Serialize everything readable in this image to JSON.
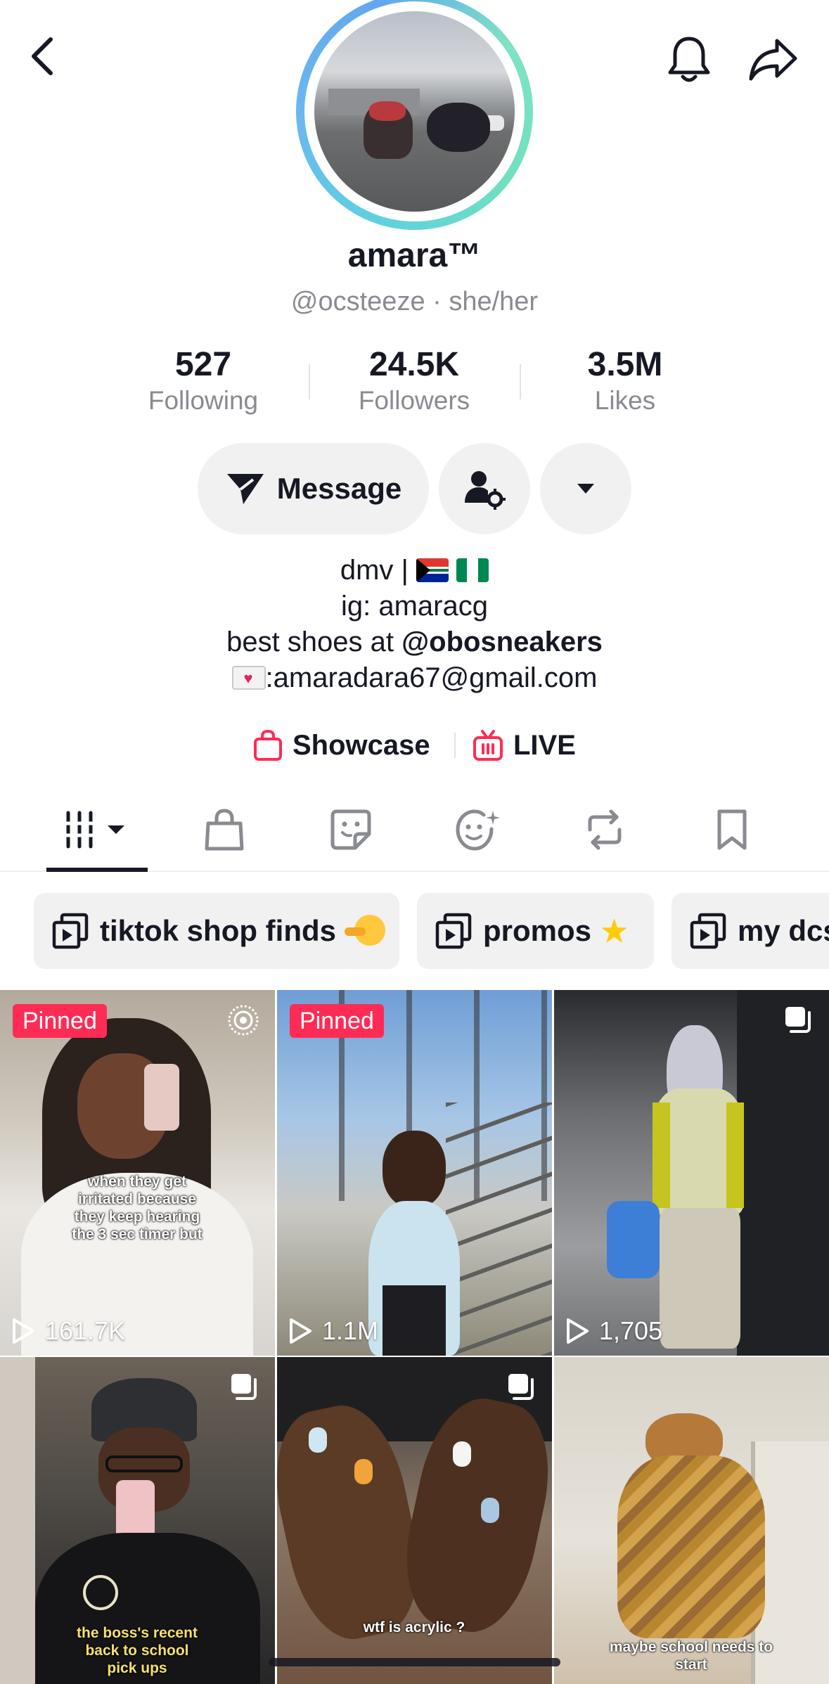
{
  "profile": {
    "name": "amara™",
    "handle": "@ocsteeze · she/her"
  },
  "stats": {
    "following": {
      "value": "527",
      "label": "Following"
    },
    "followers": {
      "value": "24.5K",
      "label": "Followers"
    },
    "likes": {
      "value": "3.5M",
      "label": "Likes"
    }
  },
  "actions": {
    "message_label": "Message"
  },
  "bio": {
    "line1": "dmv |",
    "line2": "ig: amaracg",
    "line3_prefix": "best shoes at",
    "line3_mention": "@obosneakers",
    "line4": ":amaradara67@gmail.com"
  },
  "links": {
    "showcase": "Showcase",
    "live": "LIVE"
  },
  "tabs": [
    {
      "icon": "videos-grid-icon",
      "active": true
    },
    {
      "icon": "shop-bag-icon",
      "active": false
    },
    {
      "icon": "sticker-icon",
      "active": false
    },
    {
      "icon": "liked-face-icon",
      "active": false
    },
    {
      "icon": "repost-icon",
      "active": false
    },
    {
      "icon": "bookmark-icon",
      "active": false
    }
  ],
  "playlists": [
    {
      "label": "tiktok shop finds"
    },
    {
      "label": "promos"
    },
    {
      "label": "my dcs"
    }
  ],
  "videos": [
    {
      "badge": "Pinned",
      "views": "161.7K",
      "caption": "when they get irritated because they keep hearing the 3 sec timer but"
    },
    {
      "badge": "Pinned",
      "views": "1.1M"
    },
    {
      "views": "1,705"
    },
    {
      "caption": "the boss's recent back to school pick ups"
    },
    {
      "caption": "wtf is acrylic ?"
    },
    {
      "caption": "maybe school needs to start"
    }
  ],
  "colors": {
    "accent": "#fe2c55",
    "text": "#161823",
    "muted": "#8a8b91",
    "pill": "#f1f1f2"
  }
}
